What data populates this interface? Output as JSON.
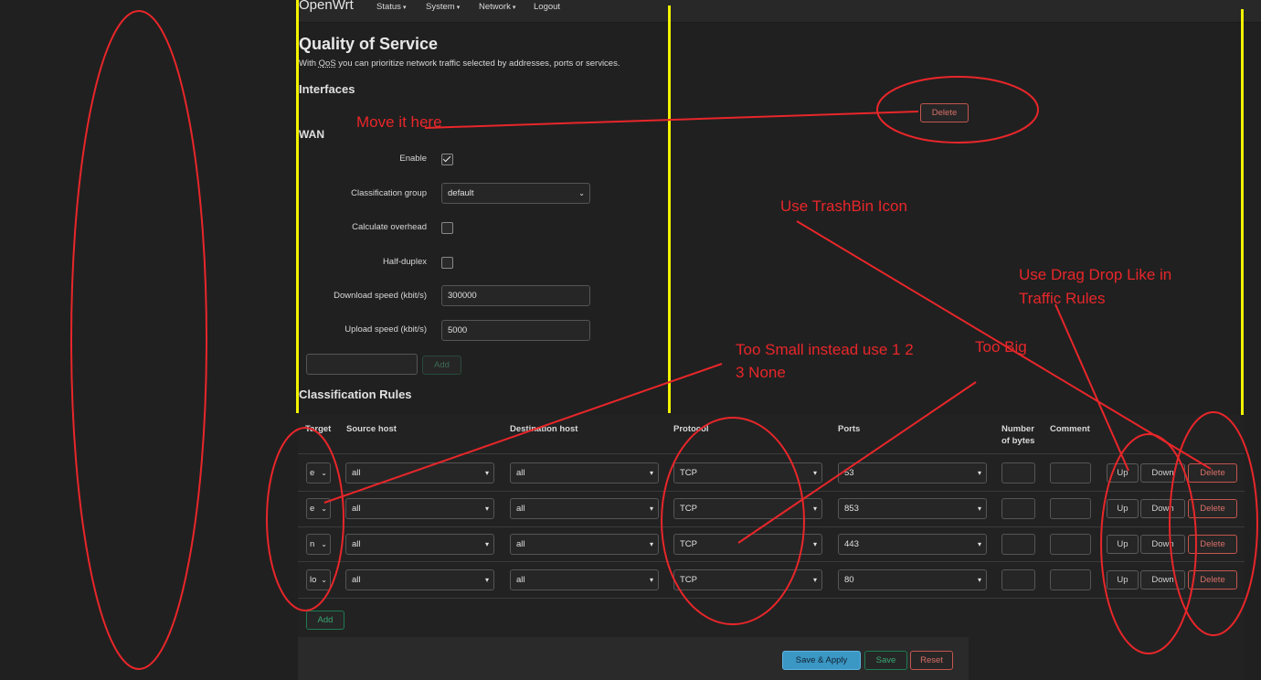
{
  "navbar": {
    "brand": "OpenWrt",
    "menu": [
      {
        "label": "Status"
      },
      {
        "label": "System"
      },
      {
        "label": "Network"
      },
      {
        "label": "Logout"
      }
    ]
  },
  "page": {
    "title": "Quality of Service",
    "desc_pre": "With ",
    "desc_abbr": "QoS",
    "desc_post": " you can prioritize network traffic selected by addresses, ports or services."
  },
  "interfaces": {
    "title": "Interfaces",
    "delete_label": "Delete",
    "wan_title": "WAN",
    "enable_label": "Enable",
    "enable_checked": true,
    "group_label": "Classification group",
    "group_value": "default",
    "overhead_label": "Calculate overhead",
    "halfduplex_label": "Half-duplex",
    "download_label": "Download speed (kbit/s)",
    "download_value": "300000",
    "upload_label": "Upload speed (kbit/s)",
    "upload_value": "5000",
    "add_label": "Add"
  },
  "rules": {
    "title": "Classification Rules",
    "headers": {
      "target": "Target",
      "source": "Source host",
      "destination": "Destination host",
      "protocol": "Protocol",
      "ports": "Ports",
      "bytes_line1": "Number",
      "bytes_line2": "of bytes",
      "comment": "Comment"
    },
    "rows": [
      {
        "target": "e",
        "source": "all",
        "destination": "all",
        "protocol": "TCP",
        "ports": "53"
      },
      {
        "target": "e",
        "source": "all",
        "destination": "all",
        "protocol": "TCP",
        "ports": "853"
      },
      {
        "target": "n",
        "source": "all",
        "destination": "all",
        "protocol": "TCP",
        "ports": "443"
      },
      {
        "target": "lo",
        "source": "all",
        "destination": "all",
        "protocol": "TCP",
        "ports": "80"
      }
    ],
    "up_label": "Up",
    "down_label": "Down",
    "delete_label": "Delete",
    "add_label": "Add"
  },
  "footer": {
    "save_apply": "Save & Apply",
    "save": "Save",
    "reset": "Reset"
  },
  "annotations": {
    "move_it_here": "Move it here",
    "use_trashbin": "Use TrashBin Icon",
    "drag_drop_1": "Use Drag Drop Like in",
    "drag_drop_2": "Traffic Rules",
    "too_small_1": "Too Small instead use 1 2",
    "too_small_2": "3 None",
    "too_big": "Too Big"
  },
  "colors": {
    "annotation_red": "#e8262a",
    "highlight_yellow": "#f2f200",
    "background": "#202020"
  }
}
